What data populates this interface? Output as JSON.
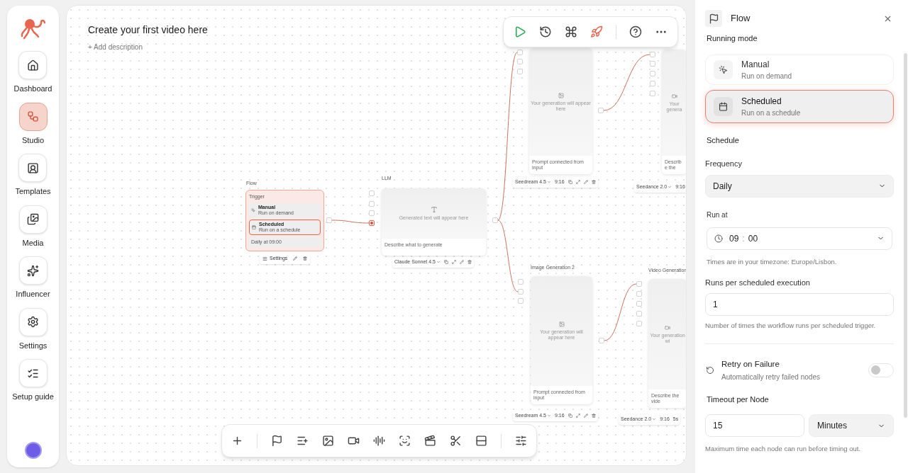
{
  "sidebar": {
    "items": [
      {
        "label": "Dashboard",
        "selected": false
      },
      {
        "label": "Studio",
        "selected": true
      },
      {
        "label": "Templates",
        "selected": false
      },
      {
        "label": "Media",
        "selected": false
      },
      {
        "label": "Influencer",
        "selected": false
      },
      {
        "label": "Settings",
        "selected": false
      },
      {
        "label": "Setup guide",
        "selected": false
      }
    ]
  },
  "canvas": {
    "title": "Create your first video here",
    "description_link": "+ Add description",
    "nodes": [
      {
        "kind": "flow",
        "title": "Flow",
        "trigger_label": "Trigger",
        "options": [
          {
            "label": "Manual",
            "sub": "Run on demand",
            "selected": false
          },
          {
            "label": "Scheduled",
            "sub": "Run on a schedule",
            "selected": true
          }
        ],
        "summary": "Daily at 09:00",
        "footer": "Settings"
      },
      {
        "kind": "text",
        "title": "LLM",
        "preview": "Generated text will appear here",
        "prompt": "Describe what to generate",
        "model": "Claude Sonnet 4.5"
      },
      {
        "kind": "image",
        "preview": "Your generation will appear here",
        "prompt": "Prompt connected from input",
        "model": "Seedream 4.5",
        "ratio": "9:16"
      },
      {
        "kind": "video",
        "preview": "Your genera",
        "prompt": "Describe the",
        "model": "Seedance 2.0",
        "ratio": "9:16"
      },
      {
        "kind": "image",
        "title": "Image Generation 2",
        "preview": "Your generation will appear here",
        "prompt": "Prompt connected from input",
        "model": "Seedream 4.5",
        "ratio": "9:16"
      },
      {
        "kind": "video",
        "title": "Video Generation",
        "preview": "Your generation wi",
        "prompt": "Describe the vide",
        "model": "Seedance 2.0",
        "ratio": "9:16",
        "duration": "5s"
      }
    ]
  },
  "panel": {
    "title": "Flow",
    "running_mode_label": "Running mode",
    "modes": [
      {
        "label": "Manual",
        "sub": "Run on demand",
        "selected": false
      },
      {
        "label": "Scheduled",
        "sub": "Run on a schedule",
        "selected": true
      }
    ],
    "schedule_heading": "Schedule",
    "frequency": {
      "label": "Frequency",
      "value": "Daily"
    },
    "run_at": {
      "label": "Run at",
      "hour": "09",
      "separator": ":",
      "minute": "00",
      "hint": "Times are in your timezone: Europe/Lisbon."
    },
    "runs": {
      "label": "Runs per scheduled execution",
      "value": "1",
      "hint": "Number of times the workflow runs per scheduled trigger."
    },
    "retry": {
      "label": "Retry on Failure",
      "sub": "Automatically retry failed nodes",
      "on": false
    },
    "timeout": {
      "label": "Timeout per Node",
      "value": "15",
      "unit": "Minutes",
      "hint": "Maximum time each node can run before timing out."
    }
  }
}
